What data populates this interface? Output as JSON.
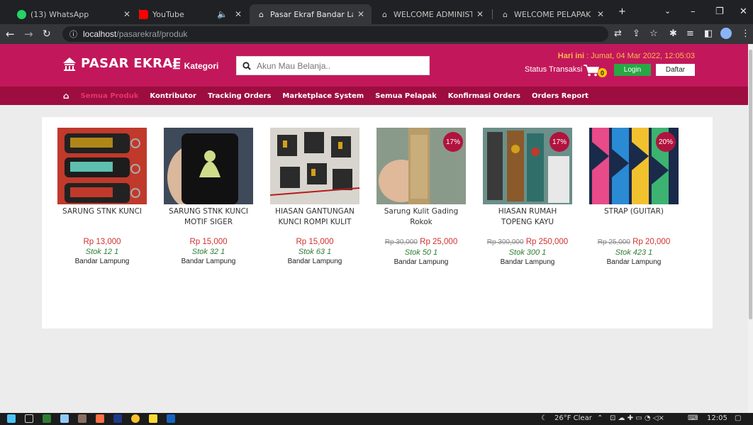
{
  "browser": {
    "tabs": [
      {
        "title": "(13) WhatsApp",
        "icon": "whatsapp-icon"
      },
      {
        "title": "YouTube",
        "icon": "youtube-icon"
      },
      {
        "title": "Pasar Ekraf Bandar Lampung",
        "icon": "site-icon"
      },
      {
        "title": "WELCOME ADMINISTRATOR",
        "icon": "site-icon"
      },
      {
        "title": "WELCOME PELAPAK",
        "icon": "site-icon"
      }
    ],
    "url_host": "localhost",
    "url_path": "/pasarekraf/produk"
  },
  "header": {
    "logo": "PASAR EKRAF",
    "kategori_label": "Kategori",
    "search_placeholder": "Akun Mau Belanja..",
    "hari_label": "Hari ini",
    "hari_value": " : Jumat, 04 Mar 2022, 12:05:03",
    "status_label": "Status Transaksi",
    "cart_count": "0",
    "login_label": "Login",
    "daftar_label": "Daftar"
  },
  "nav": {
    "items": [
      "Semua Produk",
      "Kontributor",
      "Tracking Orders",
      "Marketplace System",
      "Semua Pelapak",
      "Konfirmasi Orders",
      "Orders Report"
    ]
  },
  "products": [
    {
      "name": "SARUNG STNK KUNCI",
      "old_price": "",
      "price": "Rp 13,000",
      "stok": "Stok 12 1",
      "location": "Bandar Lampung",
      "discount": ""
    },
    {
      "name": "SARUNG STNK KUNCI MOTIF SIGER",
      "old_price": "",
      "price": "Rp 15,000",
      "stok": "Stok 32 1",
      "location": "Bandar Lampung",
      "discount": ""
    },
    {
      "name": "HIASAN GANTUNGAN KUNCI ROMPI KULIT",
      "old_price": "",
      "price": "Rp 15,000",
      "stok": "Stok 63 1",
      "location": "Bandar Lampung",
      "discount": ""
    },
    {
      "name": "Sarung Kulit Gading Rokok",
      "old_price": "Rp 30,000",
      "price": "Rp 25,000",
      "stok": "Stok 50 1",
      "location": "Bandar Lampung",
      "discount": "17%"
    },
    {
      "name": "HIASAN RUMAH TOPENG KAYU",
      "old_price": "Rp 300,000",
      "price": "Rp 250,000",
      "stok": "Stok 300 1",
      "location": "Bandar Lampung",
      "discount": "17%"
    },
    {
      "name": "STRAP (GUITAR)",
      "old_price": "Rp 25,000",
      "price": "Rp 20,000",
      "stok": "Stok 423 1",
      "location": "Bandar Lampung",
      "discount": "20%"
    }
  ],
  "taskbar": {
    "weather": "26°F  Clear",
    "time": "12:05"
  },
  "colors": {
    "header": "#c2185b",
    "nav": "#9d0d3f",
    "accent": "#e8336d",
    "price": "#d32f2f",
    "stok": "#2e7d32",
    "login": "#28a745"
  }
}
